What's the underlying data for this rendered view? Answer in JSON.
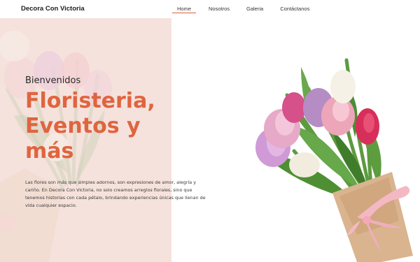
{
  "brand": {
    "name": "Decora Con Victoria"
  },
  "nav": {
    "items": [
      {
        "label": "Home",
        "active": true
      },
      {
        "label": "Nosotros"
      },
      {
        "label": "Galeria"
      },
      {
        "label": "Contáctanos"
      }
    ]
  },
  "hero": {
    "welcome": "Bienvenidos",
    "headline_line1": "Floristeria,",
    "headline_line2": "Eventos y",
    "headline_line3": "más",
    "description": "Las flores son más que simples adornos, son expresiones de amor, alegría y cariño. En Decora Con Victoria, no solo creamos arreglos florales, sino que tenemos historias con cada pétalo, brindando experiencias únicas que llenan de vida cualquier espacio."
  },
  "colors": {
    "accent": "#e0643f",
    "hero_left_bg": "#f2dfd9",
    "nav_underline": "#e05a3a"
  },
  "images": {
    "left": "faded-tulip-bouquet",
    "right": "tulip-bouquet-kraft-paper-pink-ribbon"
  }
}
